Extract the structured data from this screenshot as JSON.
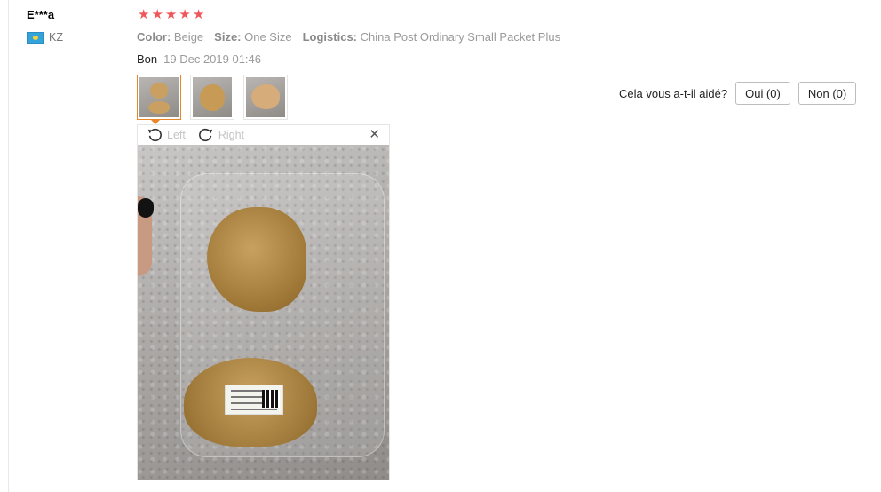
{
  "review": {
    "username": "E***a",
    "country_code": "KZ",
    "rating": 5,
    "star_color": "#f0575c",
    "attributes": [
      {
        "key": "Color:",
        "value": "Beige"
      },
      {
        "key": "Size:",
        "value": "One Size"
      },
      {
        "key": "Logistics:",
        "value": "China Post Ordinary Small Packet Plus"
      }
    ],
    "text": "Bon",
    "date": "19 Dec 2019 01:46"
  },
  "viewer": {
    "rotate_left": "Left",
    "rotate_right": "Right",
    "close_glyph": "✕",
    "thumbnail_count": 3,
    "active_thumbnail": 1,
    "accent": "#e8872a"
  },
  "helpful": {
    "question": "Cela vous a-t-il aidé?",
    "yes_label": "Oui (0)",
    "no_label": "Non (0)"
  },
  "icons": [
    "flag-icon",
    "star-icon",
    "rotate-left-icon",
    "rotate-right-icon",
    "close-icon"
  ]
}
